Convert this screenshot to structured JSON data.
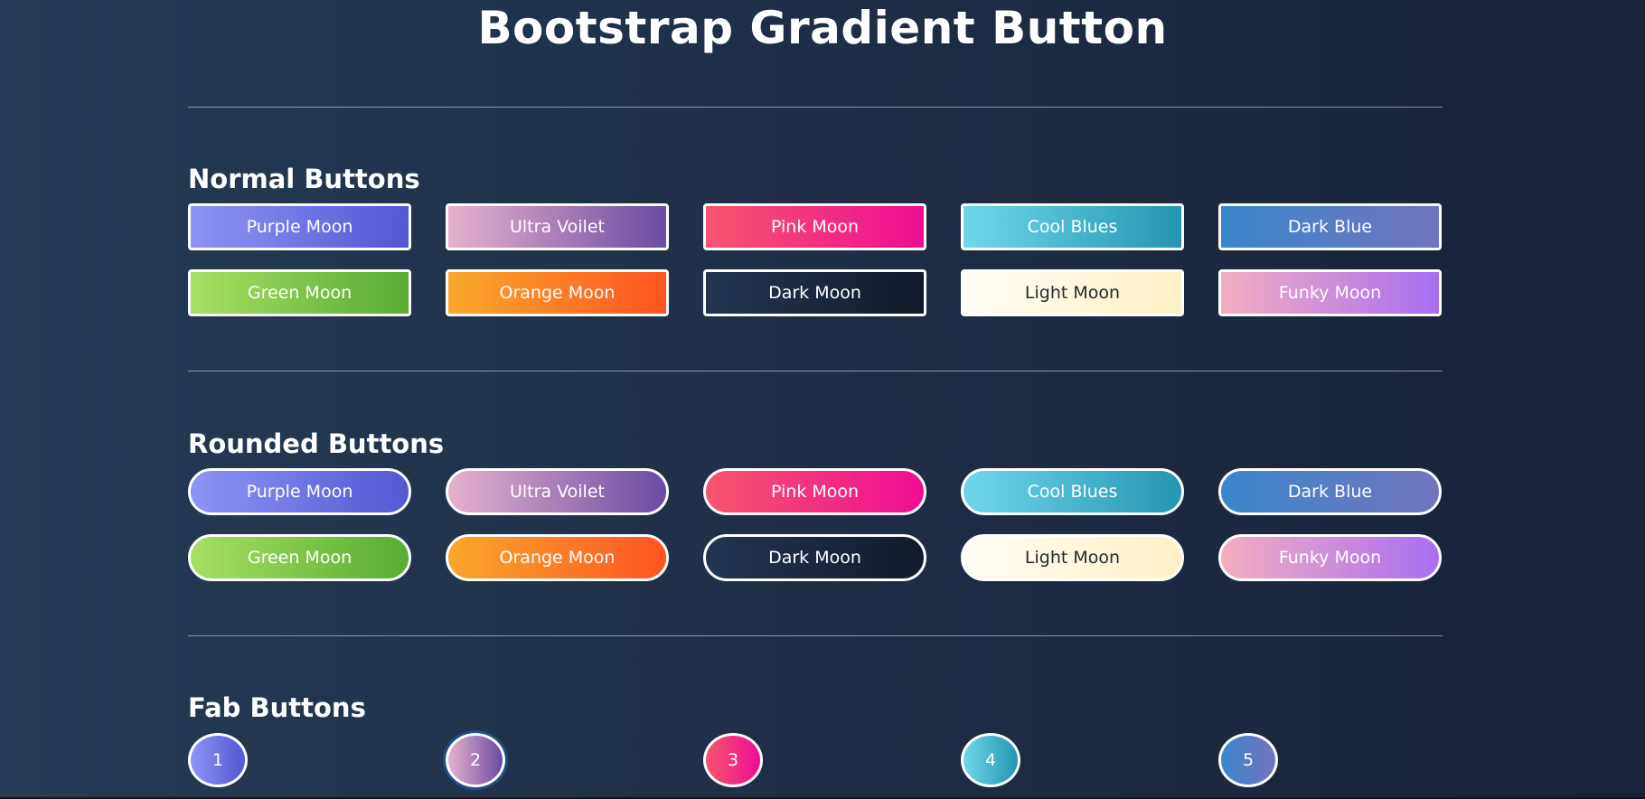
{
  "page": {
    "title": "Bootstrap Gradient Button"
  },
  "sections": {
    "normal": {
      "title": "Normal Buttons"
    },
    "rounded": {
      "title": "Rounded Buttons"
    },
    "fab": {
      "title": "Fab Buttons"
    }
  },
  "buttons": {
    "purple_moon": {
      "label": "Purple Moon",
      "from": "#8e95f5",
      "to": "#5457d3"
    },
    "ultra_voilet": {
      "label": "Ultra Voilet",
      "from": "#e6b2cc",
      "to": "#6a4ba4"
    },
    "pink_moon": {
      "label": "Pink Moon",
      "from": "#f6566e",
      "to": "#ee0d92"
    },
    "cool_blues": {
      "label": "Cool Blues",
      "from": "#6fd7ec",
      "to": "#2595b2"
    },
    "dark_blue": {
      "label": "Dark Blue",
      "from": "#3a87cc",
      "to": "#7274bd"
    },
    "green_moon": {
      "label": "Green Moon",
      "from": "#a5e064",
      "to": "#57ad32"
    },
    "orange_moon": {
      "label": "Orange Moon",
      "from": "#f9a82b",
      "to": "#fd5421"
    },
    "dark_moon": {
      "label": "Dark Moon",
      "from": "#243553",
      "to": "#121a2a"
    },
    "light_moon": {
      "label": "Light Moon",
      "from": "#fffdf6",
      "to": "#fff0c4"
    },
    "funky_moon": {
      "label": "Funky Moon",
      "from": "#f3aec0",
      "to": "#a86ef2"
    }
  },
  "fab": {
    "b1": {
      "label": "1",
      "from": "#8e95f5",
      "to": "#5457d3"
    },
    "b2": {
      "label": "2",
      "from": "#e6b2cc",
      "to": "#6a4ba4"
    },
    "b3": {
      "label": "3",
      "from": "#f6566e",
      "to": "#ee0d92"
    },
    "b4": {
      "label": "4",
      "from": "#6fd7ec",
      "to": "#2595b2"
    },
    "b5": {
      "label": "5",
      "from": "#3a87cc",
      "to": "#7274bd"
    }
  }
}
